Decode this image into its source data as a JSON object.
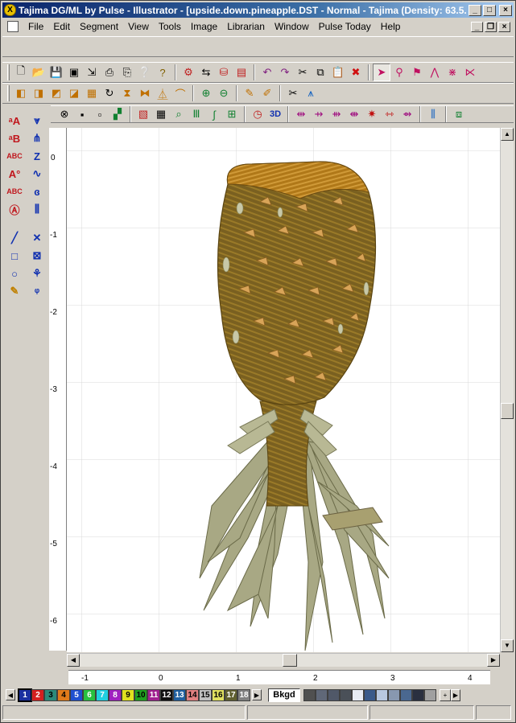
{
  "window": {
    "title": "Tajima DG/ML by Pulse - Illustrator - [upside.down.pineapple.DST - Normal - Tajima (Density: 63.5...",
    "icon_label": "X"
  },
  "menu": [
    "File",
    "Edit",
    "Segment",
    "View",
    "Tools",
    "Image",
    "Librarian",
    "Window",
    "Pulse Today",
    "Help"
  ],
  "ruler": {
    "top_labels": [
      "-1",
      "0",
      "1",
      "2",
      "3",
      "4"
    ],
    "left_labels": [
      "0",
      "-1",
      "-2",
      "-3",
      "-4",
      "-5",
      "-6"
    ]
  },
  "palette": {
    "colors": [
      {
        "n": "1",
        "c": "#1a2fa0",
        "t": "#fff"
      },
      {
        "n": "2",
        "c": "#d42020",
        "t": "#fff"
      },
      {
        "n": "3",
        "c": "#2c8a7a",
        "t": "#000"
      },
      {
        "n": "4",
        "c": "#e07a1a",
        "t": "#000"
      },
      {
        "n": "5",
        "c": "#2050d0",
        "t": "#fff"
      },
      {
        "n": "6",
        "c": "#28c040",
        "t": "#fff"
      },
      {
        "n": "7",
        "c": "#20d0e0",
        "t": "#fff"
      },
      {
        "n": "8",
        "c": "#a020c0",
        "t": "#fff"
      },
      {
        "n": "9",
        "c": "#e0e020",
        "t": "#000"
      },
      {
        "n": "10",
        "c": "#20a020",
        "t": "#000"
      },
      {
        "n": "11",
        "c": "#a02090",
        "t": "#fff"
      },
      {
        "n": "12",
        "c": "#101010",
        "t": "#fff"
      },
      {
        "n": "13",
        "c": "#2060a0",
        "t": "#fff"
      },
      {
        "n": "14",
        "c": "#e08080",
        "t": "#000"
      },
      {
        "n": "15",
        "c": "#c0c0c0",
        "t": "#000"
      },
      {
        "n": "16",
        "c": "#e0e060",
        "t": "#000"
      },
      {
        "n": "17",
        "c": "#606030",
        "t": "#fff"
      },
      {
        "n": "18",
        "c": "#808080",
        "t": "#fff"
      }
    ],
    "bkgd_label": "Bkgd",
    "greys": [
      "#505050",
      "#606878",
      "#505868",
      "#4a5058",
      "#e8ecf4",
      "#3a5a8a",
      "#b8c8e0",
      "#8898b0",
      "#4a6890",
      "#2a3040",
      "#a0a0a0"
    ]
  },
  "colors": {
    "title_start": "#0a246a",
    "title_end": "#a6caf0",
    "grid": "#d8d8d8",
    "pineapple_body": "#8a6a20",
    "pineapple_leaf": "#a8a884"
  }
}
